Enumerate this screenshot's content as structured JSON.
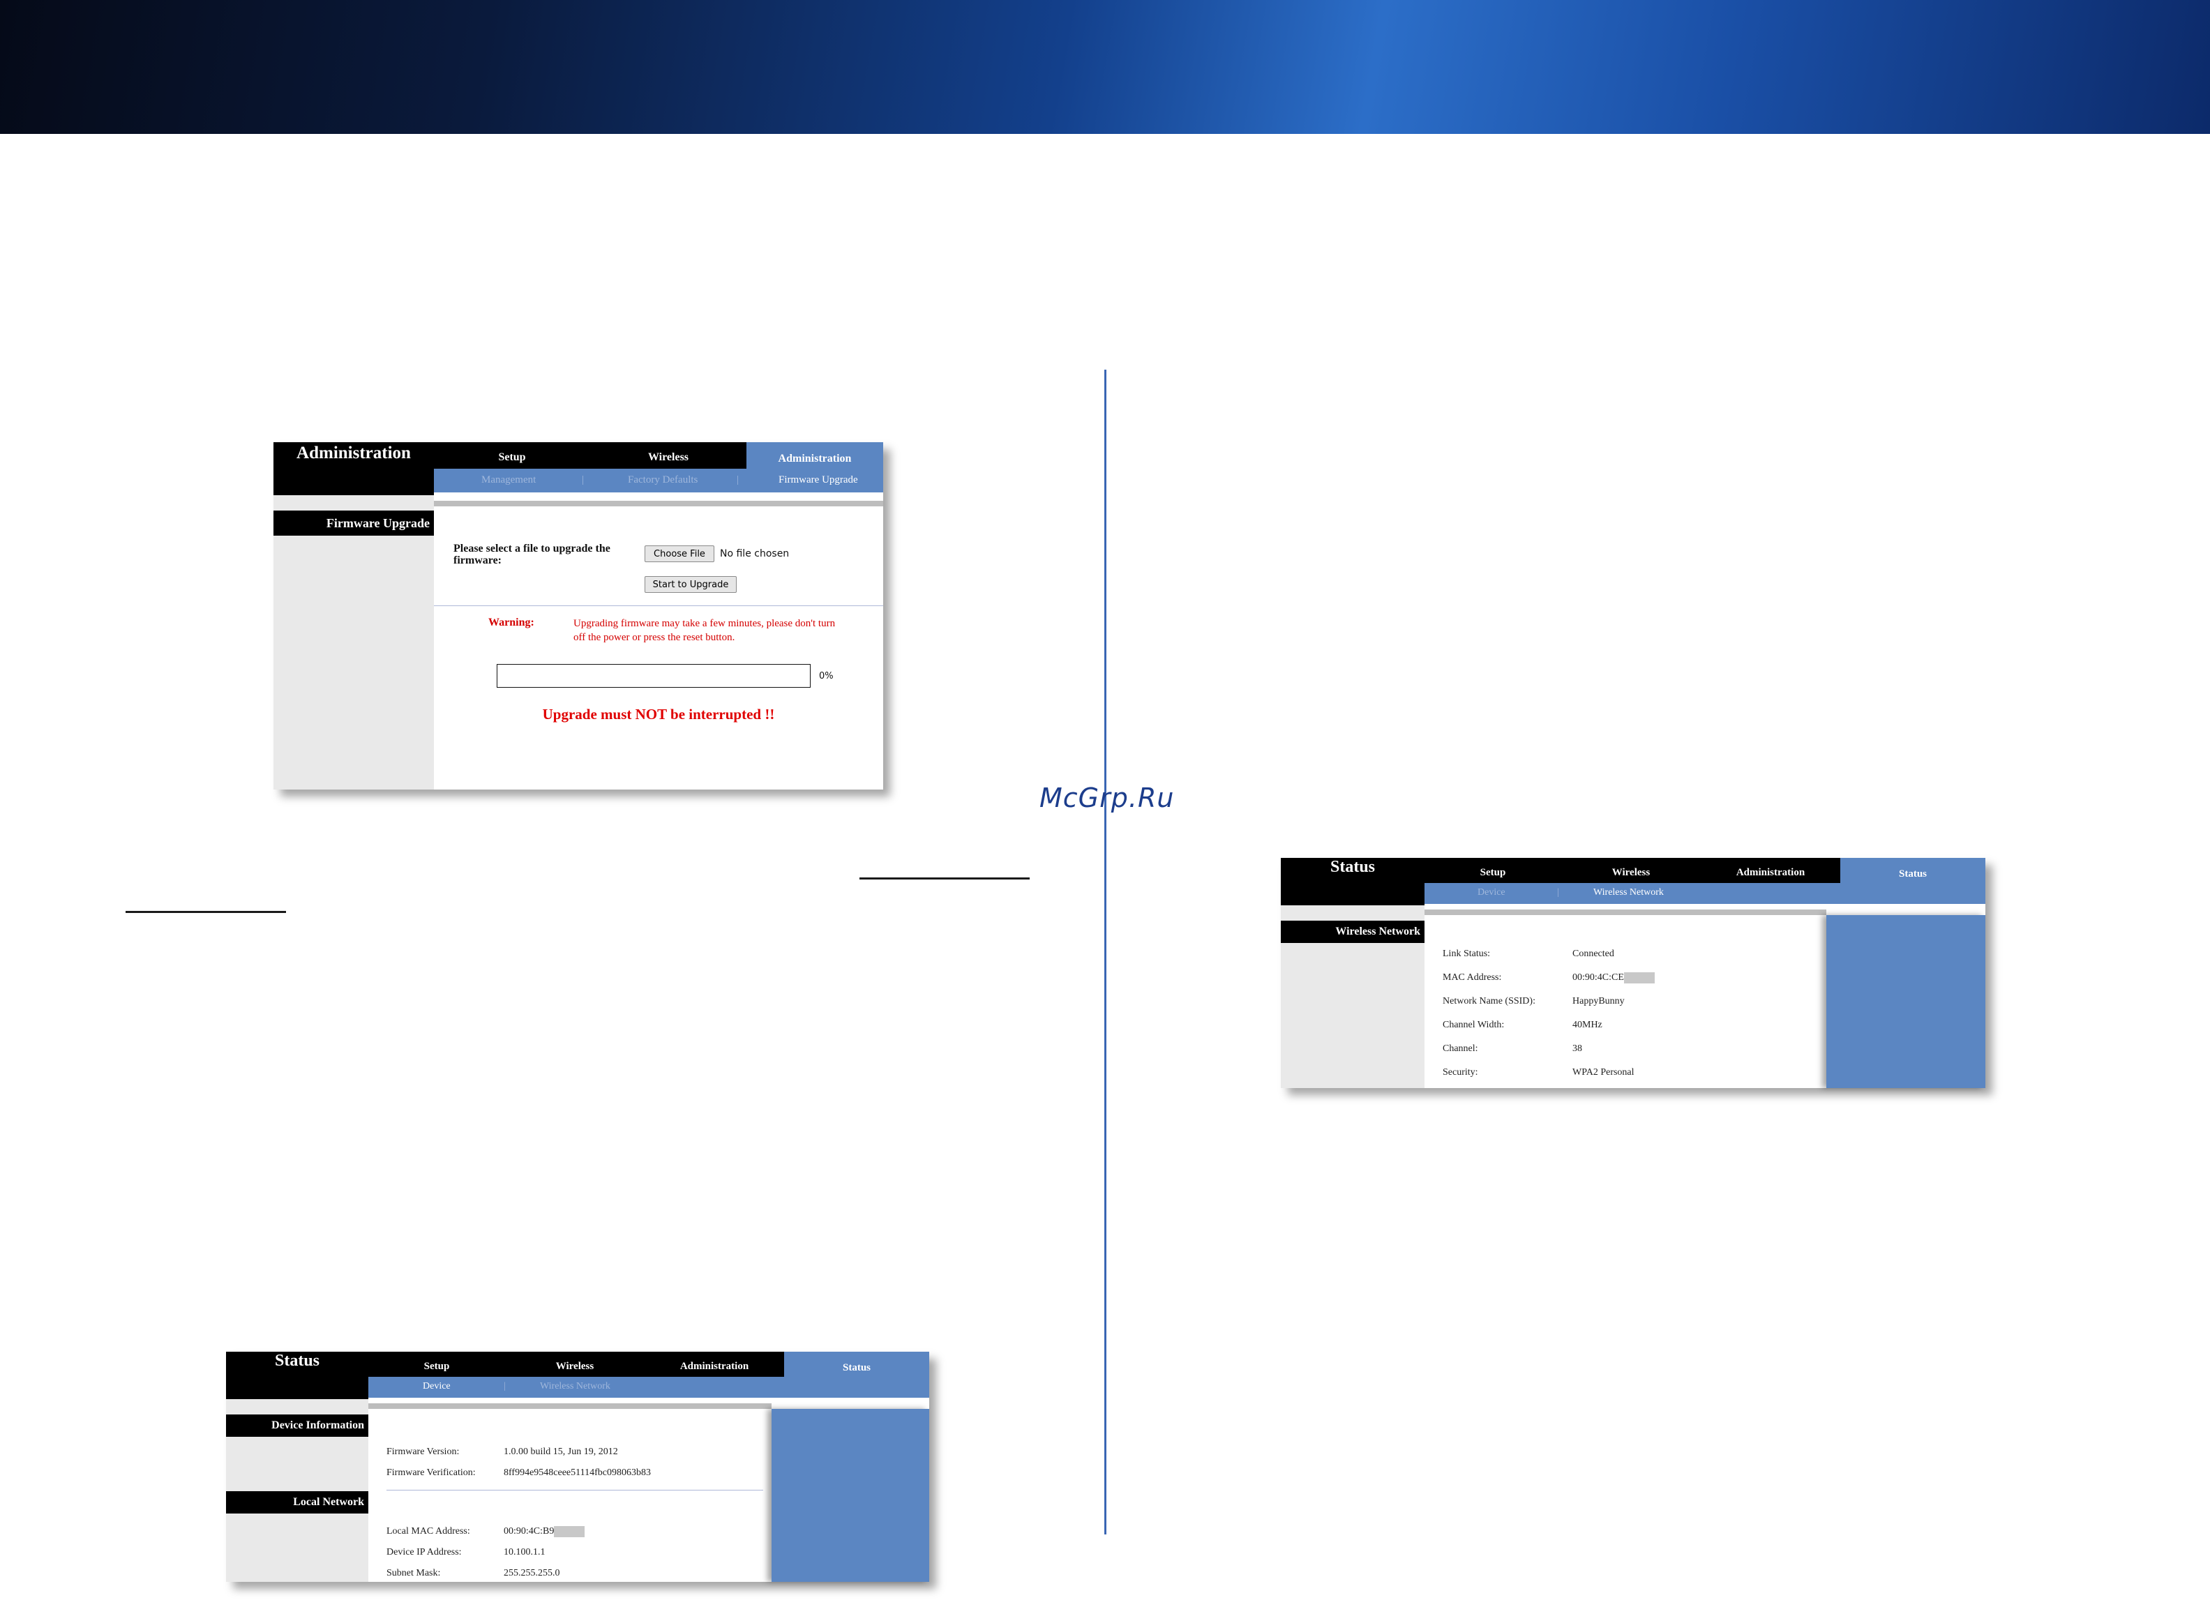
{
  "watermark": "McGrp.Ru",
  "nav": {
    "setup": "Setup",
    "wireless": "Wireless",
    "administration": "Administration",
    "status": "Status"
  },
  "admin_panel": {
    "title": "Administration",
    "section": "Firmware Upgrade",
    "subtabs": [
      "Management",
      "|",
      "Factory Defaults",
      "|",
      "Firmware Upgrade"
    ],
    "select_label": "Please select a file to upgrade the firmware:",
    "choose_file": "Choose File",
    "no_file": "No file chosen",
    "start_button": "Start to Upgrade",
    "warning_label": "Warning:",
    "warning_text": "Upgrading firmware may take a few minutes, please don't turn off the power or press the reset button.",
    "progress_value": 0,
    "progress_text": "0%",
    "interrupt_msg": "Upgrade must NOT be interrupted !!"
  },
  "status_device": {
    "title": "Status",
    "subtabs": [
      "Device",
      "|",
      "Wireless Network"
    ],
    "section_device": "Device Information",
    "section_local": "Local Network",
    "firmware_version_label": "Firmware Version:",
    "firmware_version": "1.0.00 build 15, Jun 19, 2012",
    "firmware_verification_label": "Firmware Verification:",
    "firmware_verification": "8ff994e9548ceee51114fbc098063b83",
    "mac_label": "Local MAC Address:",
    "mac": "00:90:4C:B9",
    "ip_label": "Device IP Address:",
    "ip": "10.100.1.1",
    "mask_label": "Subnet Mask:",
    "mask": "255.255.255.0"
  },
  "status_wireless": {
    "title": "Status",
    "subtabs": [
      "Device",
      "|",
      "Wireless Network"
    ],
    "section": "Wireless Network",
    "link_label": "Link Status:",
    "link": "Connected",
    "mac_label": "MAC Address:",
    "mac": "00:90:4C:CE",
    "ssid_label": "Network Name (SSID):",
    "ssid": "HappyBunny",
    "width_label": "Channel Width:",
    "width": "40MHz",
    "channel_label": "Channel:",
    "channel": "38",
    "security_label": "Security:",
    "security": "WPA2 Personal"
  }
}
